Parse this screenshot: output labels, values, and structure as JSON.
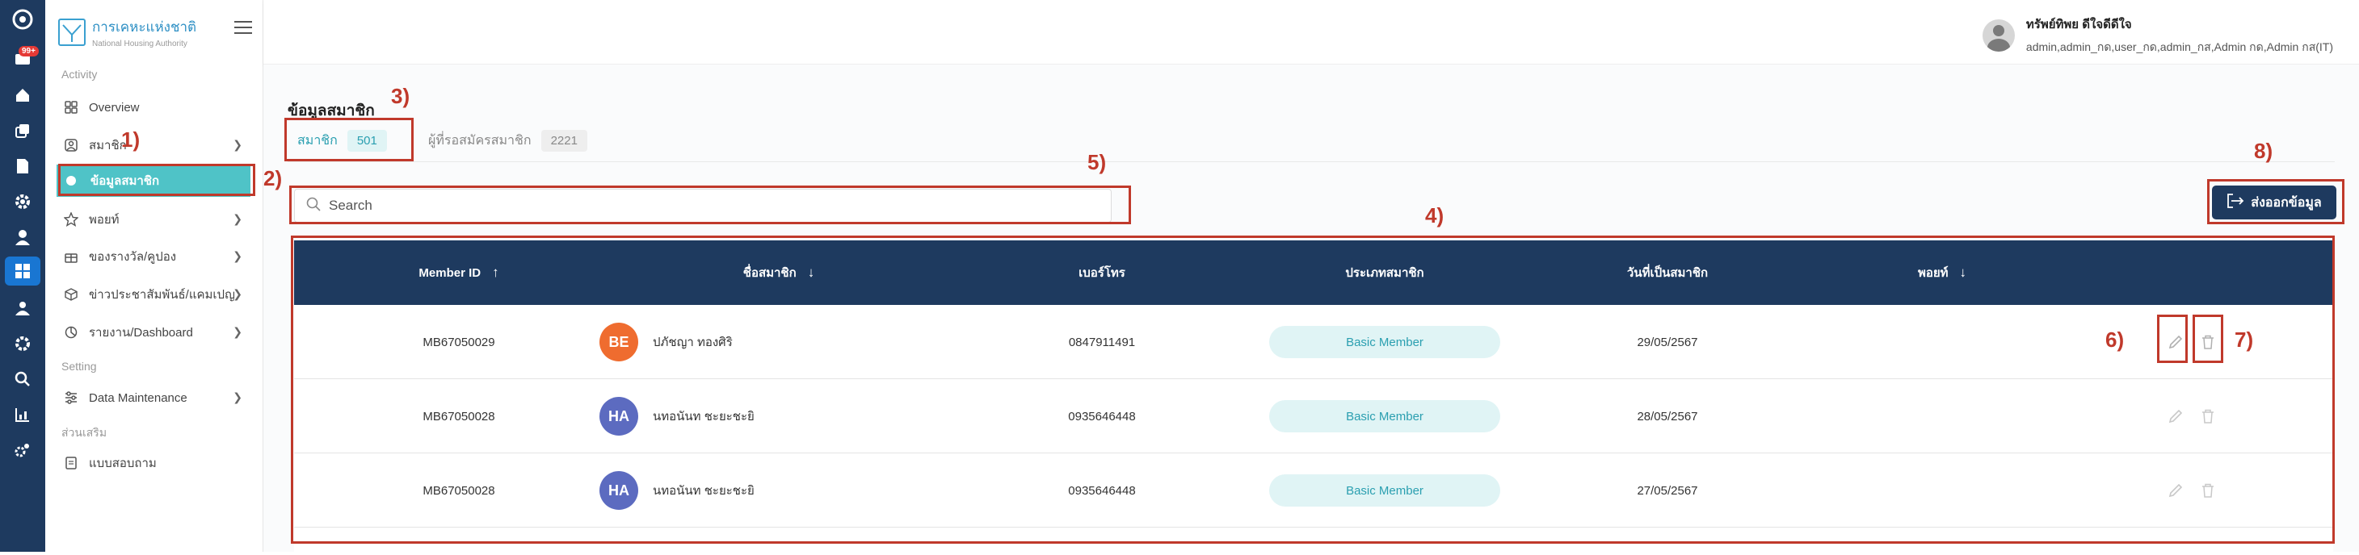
{
  "rail": {
    "badge": "99+",
    "icons": [
      "logo-icon",
      "inbox-icon",
      "home-icon",
      "copy-icon",
      "document-icon",
      "settings-icon",
      "user-icon",
      "dashboard-icon",
      "group-icon",
      "gear-icon",
      "search-icon",
      "chart-icon",
      "gears-icon"
    ]
  },
  "sidebar": {
    "logo_title": "การเคหะแห่งชาติ",
    "logo_subtitle": "National Housing Authority",
    "section_activity": "Activity",
    "section_setting": "Setting",
    "section_extra": "ส่วนเสริม",
    "items": [
      {
        "label": "Overview",
        "icon": "grid-icon"
      },
      {
        "label": "สมาชิก",
        "icon": "member-icon"
      },
      {
        "label": "ข้อมูลสมาชิก",
        "icon": "dot"
      },
      {
        "label": "พอยท์",
        "icon": "star-icon"
      },
      {
        "label": "ของรางวัล/คูปอง",
        "icon": "gift-icon"
      },
      {
        "label": "ข่าวประชาสัมพันธ์/แคมเปญ",
        "icon": "box-icon"
      },
      {
        "label": "รายงาน/Dashboard",
        "icon": "pie-icon"
      },
      {
        "label": "Data Maintenance",
        "icon": "sliders-icon"
      },
      {
        "label": "แบบสอบถาม",
        "icon": "form-icon"
      }
    ]
  },
  "header": {
    "user_name": "ทรัพย์ทิพย ดีใจดีดีใจ",
    "user_roles": "admin,admin_กด,user_กด,admin_กส,Admin กด,Admin กส(IT)"
  },
  "main": {
    "page_title": "ข้อมูลสมาชิก",
    "tabs": [
      {
        "label": "สมาชิก",
        "count": "501"
      },
      {
        "label": "ผู้ที่รอสมัครสมาชิก",
        "count": "2221"
      }
    ],
    "search_placeholder": "Search",
    "export_label": "ส่งออกข้อมูล"
  },
  "table": {
    "headers": [
      "Member ID",
      "ชื่อสมาชิก",
      "เบอร์โทร",
      "ประเภทสมาชิก",
      "วันที่เป็นสมาชิก",
      "พอยท์"
    ],
    "rows": [
      {
        "id": "MB67050029",
        "initials": "BE",
        "avatar_color": "#ef6c2f",
        "name": "ปภัชญา ทองศิริ",
        "phone": "0847911491",
        "type": "Basic Member",
        "date": "29/05/2567"
      },
      {
        "id": "MB67050028",
        "initials": "HA",
        "avatar_color": "#5c6bc0",
        "name": "นทอนันท ชะยะชะยิ",
        "phone": "0935646448",
        "type": "Basic Member",
        "date": "28/05/2567"
      },
      {
        "id": "MB67050028",
        "initials": "HA",
        "avatar_color": "#5c6bc0",
        "name": "นทอนันท ชะยะชะยิ",
        "phone": "0935646448",
        "type": "Basic Member",
        "date": "27/05/2567"
      }
    ]
  },
  "annotations": [
    "1)",
    "2)",
    "3)",
    "4)",
    "5)",
    "6)",
    "7)",
    "8)"
  ],
  "colors": {
    "navy": "#1e3a5f",
    "teal": "#4fc3c7",
    "annotation": "#c0392b"
  }
}
